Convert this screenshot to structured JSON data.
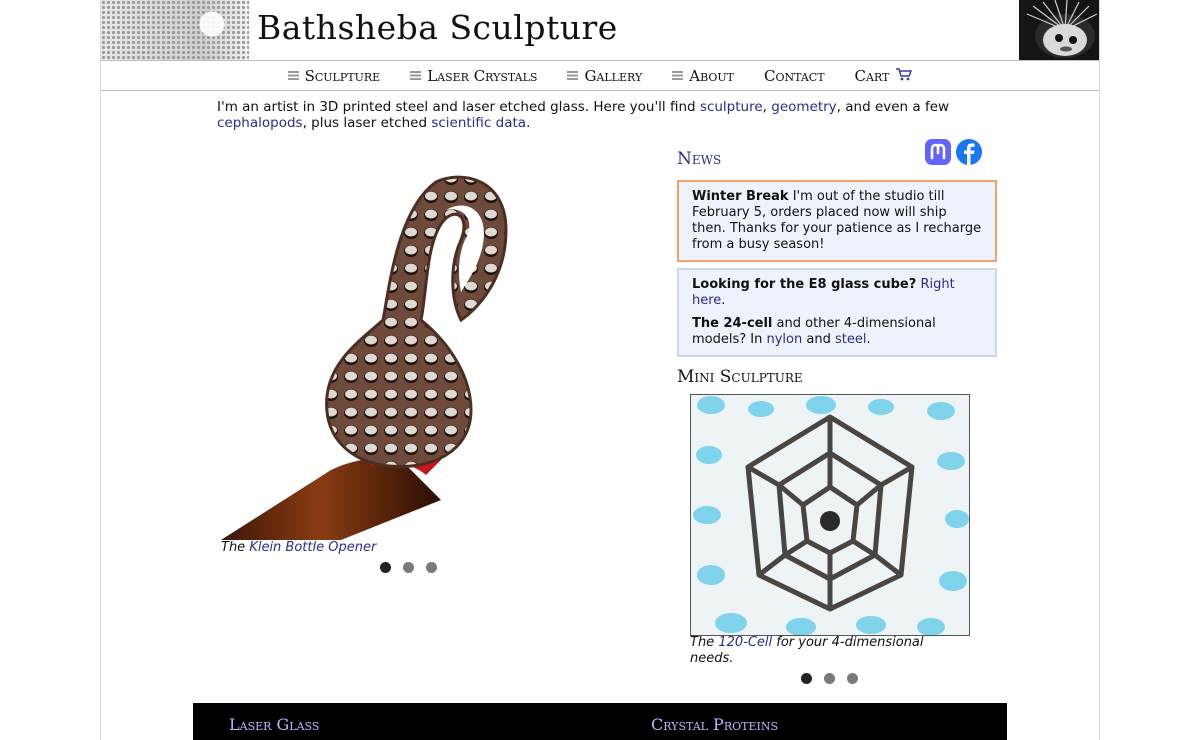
{
  "site": {
    "title": "Bathsheba Sculpture"
  },
  "nav": {
    "items": [
      {
        "label": "Sculpture",
        "has_menu": true
      },
      {
        "label": "Laser Crystals",
        "has_menu": true
      },
      {
        "label": "Gallery",
        "has_menu": true
      },
      {
        "label": "About",
        "has_menu": true
      },
      {
        "label": "Contact",
        "has_menu": false
      },
      {
        "label": "Cart",
        "has_menu": false,
        "icon": "cart-icon"
      }
    ]
  },
  "intro": {
    "t1": "I'm an artist in 3D printed steel and laser etched glass. Here you'll find ",
    "l1": "sculpture",
    "t2": ", ",
    "l2": "geometry",
    "t3": ", and even a few ",
    "l3": "cephalopods",
    "t4": ", plus laser etched ",
    "l4": "scientific data",
    "t5": "."
  },
  "hero": {
    "caption_prefix": "The ",
    "caption_link": "Klein Bottle Opener",
    "slide_count": 3,
    "active_slide": 1
  },
  "news": {
    "title": "News",
    "social": [
      {
        "name": "mastodon-icon",
        "glyph": "m",
        "color": "#6364ff"
      },
      {
        "name": "facebook-icon",
        "glyph": "f",
        "color": "#1877f2"
      }
    ],
    "box1": {
      "strong": "Winter Break",
      "text": " I'm out of the studio till February 5, orders placed now will ship then. Thanks for your patience as I recharge from a busy season!"
    },
    "box2": {
      "p1_strong": "Looking for the E8 glass cube?",
      "p1_link": "Right here",
      "p1_end": ".",
      "p2_strong": "The 24-cell",
      "p2_text": " and other 4-dimensional models? In ",
      "p2_link1": "nylon",
      "p2_and": " and ",
      "p2_link2": "steel",
      "p2_end": "."
    }
  },
  "mini": {
    "title": "Mini Sculpture",
    "caption_prefix": "The ",
    "caption_link": "120-Cell",
    "caption_suffix": " for your 4-dimensional needs.",
    "slide_count": 3,
    "active_slide": 1
  },
  "footer": {
    "links": [
      "Laser Glass",
      "Crystal Proteins"
    ]
  },
  "colors": {
    "link": "#2b2b8f",
    "news_border_winter": "#f0a36a",
    "news_bg": "#eef2fb",
    "footer_bg": "#000000",
    "footer_link": "#b8b8ff"
  }
}
